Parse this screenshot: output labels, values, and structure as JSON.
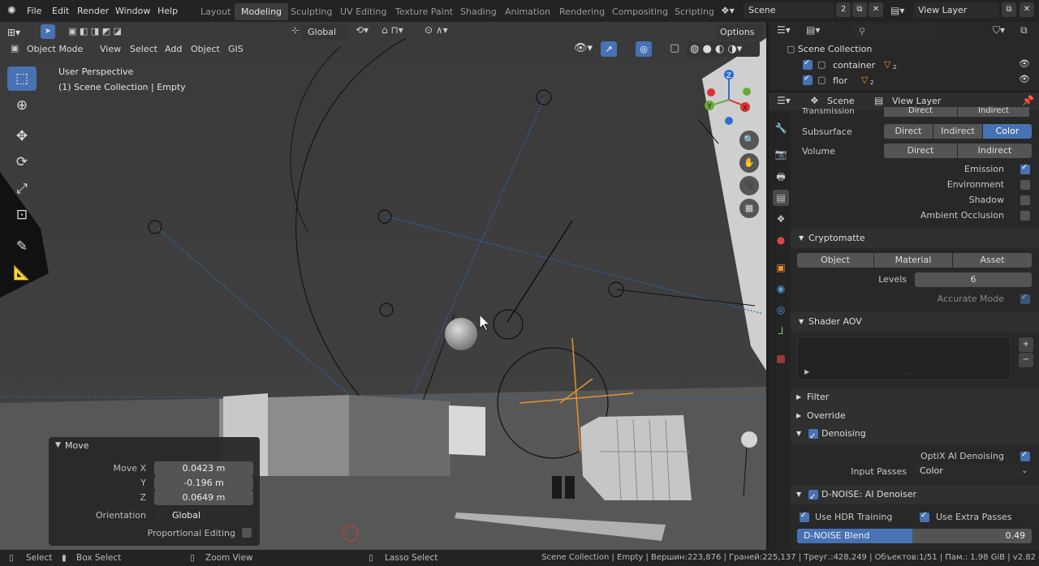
{
  "topbar": {
    "menus": [
      "File",
      "Edit",
      "Render",
      "Window",
      "Help"
    ],
    "workspaces": [
      "Layout",
      "Modeling",
      "Sculpting",
      "UV Editing",
      "Texture Paint",
      "Shading",
      "Animation",
      "Rendering",
      "Compositing",
      "Scripting"
    ],
    "active_workspace": "Modeling",
    "scene_name": "Scene",
    "scene_users": "2",
    "view_layer": "View Layer"
  },
  "viewport_header": {
    "transform_orientation": "Global",
    "options_label": "Options",
    "mode": "Object Mode",
    "menus": [
      "View",
      "Select",
      "Add",
      "Object",
      "GIS"
    ]
  },
  "viewport": {
    "perspective_label": "User Perspective",
    "context_label": "(1) Scene Collection | Empty"
  },
  "gizmo": {
    "z": "Z",
    "y": "Y",
    "x": "X"
  },
  "move_panel": {
    "title": "Move",
    "move_x_label": "Move X",
    "move_x": "0.0423 m",
    "y_label": "Y",
    "y": "-0.196 m",
    "z_label": "Z",
    "z": "0.0649 m",
    "orientation_label": "Orientation",
    "orientation": "Global",
    "proportional_label": "Proportional Editing"
  },
  "outliner": {
    "root": "Scene Collection",
    "items": [
      {
        "name": "container",
        "users": "2"
      },
      {
        "name": "flor",
        "users": "2"
      }
    ]
  },
  "properties": {
    "header_scene": "Scene",
    "header_view_layer": "View Layer",
    "transmission_label": "Transmission",
    "direct": "Direct",
    "indirect": "Indirect",
    "color": "Color",
    "subsurface_label": "Subsurface",
    "volume_label": "Volume",
    "emission_label": "Emission",
    "environment_label": "Environment",
    "shadow_label": "Shadow",
    "ao_label": "Ambient Occlusion",
    "cryptomatte_title": "Cryptomatte",
    "crypto_object": "Object",
    "crypto_material": "Material",
    "crypto_asset": "Asset",
    "levels_label": "Levels",
    "levels": "6",
    "accurate_label": "Accurate Mode",
    "shader_aov_title": "Shader AOV",
    "filter_title": "Filter",
    "override_title": "Override",
    "denoising_title": "Denoising",
    "optix_label": "OptiX AI Denoising",
    "input_passes_label": "Input Passes",
    "input_passes": "Color",
    "dnoise_title": "D-NOISE: AI Denoiser",
    "hdr_label": "Use HDR Training",
    "extra_label": "Use Extra Passes",
    "blend_label": "D-NOISE Blend",
    "blend_value": "0.49",
    "blend_fraction": 0.49
  },
  "statusbar": {
    "select": "Select",
    "box_select": "Box Select",
    "zoom_view": "Zoom View",
    "lasso_select": "Lasso Select",
    "info": "Scene Collection | Empty | Вершин:223,876 | Граней:225,137 | Треуг.:428,249 | Объектов:1/51 | Пам.: 1.98 GiB | v2.82"
  },
  "colors": {
    "accent": "#4772b3",
    "active_object": "#e8922e"
  }
}
